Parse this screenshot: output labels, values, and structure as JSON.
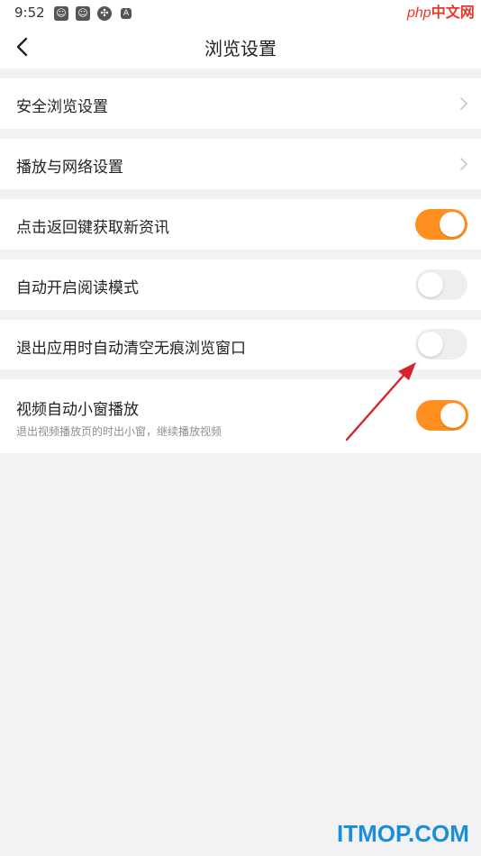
{
  "status_bar": {
    "time": "9:52",
    "icons": [
      "app-icon",
      "app-icon",
      "settings-icon",
      "a-icon"
    ]
  },
  "watermark_top": {
    "php": "php",
    "zh": "中文网"
  },
  "header": {
    "title": "浏览设置",
    "back_icon": "back-icon"
  },
  "rows": [
    {
      "label": "安全浏览设置",
      "control": "chevron"
    },
    {
      "label": "播放与网络设置",
      "control": "chevron"
    },
    {
      "label": "点击返回键获取新资讯",
      "control": "toggle",
      "on": true
    },
    {
      "label": "自动开启阅读模式",
      "control": "toggle",
      "on": false
    },
    {
      "label": "退出应用时自动清空无痕浏览窗口",
      "control": "toggle",
      "on": false
    },
    {
      "label": "视频自动小窗播放",
      "sub": "退出视频播放页的时出小窗，继续播放视频",
      "control": "toggle",
      "on": true
    }
  ],
  "colors": {
    "accent": "#ff8f1f",
    "background": "#f2f2f4",
    "annotation_arrow": "#d9232a"
  },
  "footer_watermark": "ITMOP.COM"
}
